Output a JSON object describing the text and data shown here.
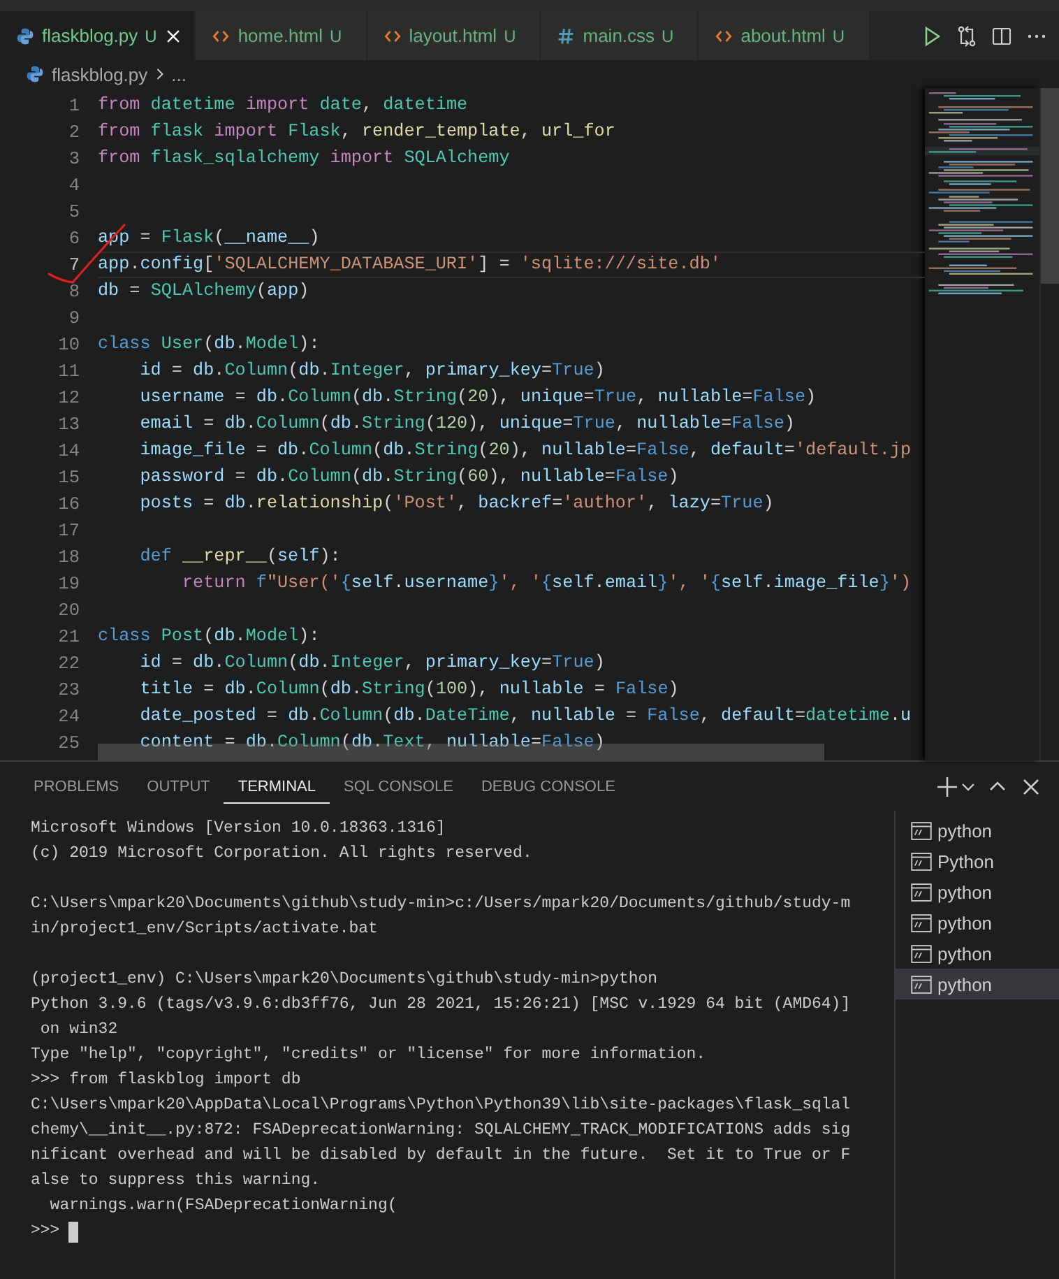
{
  "tabs": [
    {
      "label": "flaskblog.py",
      "status": "U",
      "kind": "python",
      "selected": true
    },
    {
      "label": "home.html",
      "status": "U",
      "kind": "html",
      "selected": false
    },
    {
      "label": "layout.html",
      "status": "U",
      "kind": "html",
      "selected": false
    },
    {
      "label": "main.css",
      "status": "U",
      "kind": "css",
      "selected": false
    },
    {
      "label": "about.html",
      "status": "U",
      "kind": "html",
      "selected": false
    }
  ],
  "breadcrumb": {
    "file": "flaskblog.py",
    "trail": "..."
  },
  "editor": {
    "lines": [
      {
        "number": "1",
        "current": false,
        "tokens": [
          {
            "kind": "keyword",
            "text": "from "
          },
          {
            "kind": "type",
            "text": "datetime "
          },
          {
            "kind": "keyword",
            "text": "import "
          },
          {
            "kind": "type",
            "text": "date"
          },
          {
            "kind": "plain",
            "text": ", "
          },
          {
            "kind": "type",
            "text": "datetime"
          }
        ]
      },
      {
        "number": "2",
        "current": false,
        "tokens": [
          {
            "kind": "keyword",
            "text": "from "
          },
          {
            "kind": "type",
            "text": "flask "
          },
          {
            "kind": "keyword",
            "text": "import "
          },
          {
            "kind": "type",
            "text": "Flask"
          },
          {
            "kind": "plain",
            "text": ", "
          },
          {
            "kind": "function",
            "text": "render_template"
          },
          {
            "kind": "plain",
            "text": ", "
          },
          {
            "kind": "function",
            "text": "url_for"
          }
        ]
      },
      {
        "number": "3",
        "current": false,
        "tokens": [
          {
            "kind": "keyword",
            "text": "from "
          },
          {
            "kind": "type",
            "text": "flask_sqlalchemy "
          },
          {
            "kind": "keyword",
            "text": "import "
          },
          {
            "kind": "type",
            "text": "SQLAlchemy"
          }
        ]
      },
      {
        "number": "4",
        "current": false
      },
      {
        "number": "5",
        "current": false
      },
      {
        "number": "6",
        "current": false,
        "tokens": [
          {
            "kind": "variable",
            "text": "app"
          },
          {
            "kind": "plain",
            "text": " = "
          },
          {
            "kind": "type",
            "text": "Flask"
          },
          {
            "kind": "plain",
            "text": "("
          },
          {
            "kind": "variable",
            "text": "__name__"
          },
          {
            "kind": "plain",
            "text": ")"
          }
        ]
      },
      {
        "number": "7",
        "current": true,
        "tokens": [
          {
            "kind": "variable",
            "text": "app"
          },
          {
            "kind": "plain",
            "text": "."
          },
          {
            "kind": "variable",
            "text": "config"
          },
          {
            "kind": "plain",
            "text": "["
          },
          {
            "kind": "string",
            "text": "'SQLALCHEMY_DATABASE_URI'"
          },
          {
            "kind": "plain",
            "text": "] = "
          },
          {
            "kind": "string",
            "text": "'sqlite:///site.db'"
          }
        ]
      },
      {
        "number": "8",
        "current": false,
        "tokens": [
          {
            "kind": "variable",
            "text": "db"
          },
          {
            "kind": "plain",
            "text": " = "
          },
          {
            "kind": "type",
            "text": "SQLAlchemy"
          },
          {
            "kind": "plain",
            "text": "("
          },
          {
            "kind": "variable",
            "text": "app"
          },
          {
            "kind": "plain",
            "text": ")"
          }
        ]
      },
      {
        "number": "9",
        "current": false
      },
      {
        "number": "10",
        "current": false,
        "tokens": [
          {
            "kind": "constant",
            "text": "class "
          },
          {
            "kind": "type",
            "text": "User"
          },
          {
            "kind": "plain",
            "text": "("
          },
          {
            "kind": "variable",
            "text": "db"
          },
          {
            "kind": "plain",
            "text": "."
          },
          {
            "kind": "type",
            "text": "Model"
          },
          {
            "kind": "plain",
            "text": "):"
          }
        ]
      },
      {
        "number": "11",
        "current": false,
        "tokens": [
          {
            "kind": "variable",
            "text": "    id"
          },
          {
            "kind": "plain",
            "text": " = "
          },
          {
            "kind": "variable",
            "text": "db"
          },
          {
            "kind": "plain",
            "text": "."
          },
          {
            "kind": "type",
            "text": "Column"
          },
          {
            "kind": "plain",
            "text": "("
          },
          {
            "kind": "variable",
            "text": "db"
          },
          {
            "kind": "plain",
            "text": "."
          },
          {
            "kind": "type",
            "text": "Integer"
          },
          {
            "kind": "plain",
            "text": ", "
          },
          {
            "kind": "variable",
            "text": "primary_key"
          },
          {
            "kind": "plain",
            "text": "="
          },
          {
            "kind": "constant",
            "text": "True"
          },
          {
            "kind": "plain",
            "text": ")"
          }
        ]
      },
      {
        "number": "12",
        "current": false,
        "tokens": [
          {
            "kind": "variable",
            "text": "    username"
          },
          {
            "kind": "plain",
            "text": " = "
          },
          {
            "kind": "variable",
            "text": "db"
          },
          {
            "kind": "plain",
            "text": "."
          },
          {
            "kind": "type",
            "text": "Column"
          },
          {
            "kind": "plain",
            "text": "("
          },
          {
            "kind": "variable",
            "text": "db"
          },
          {
            "kind": "plain",
            "text": "."
          },
          {
            "kind": "type",
            "text": "String"
          },
          {
            "kind": "plain",
            "text": "("
          },
          {
            "kind": "number",
            "text": "20"
          },
          {
            "kind": "plain",
            "text": "), "
          },
          {
            "kind": "variable",
            "text": "unique"
          },
          {
            "kind": "plain",
            "text": "="
          },
          {
            "kind": "constant",
            "text": "True"
          },
          {
            "kind": "plain",
            "text": ", "
          },
          {
            "kind": "variable",
            "text": "nullable"
          },
          {
            "kind": "plain",
            "text": "="
          },
          {
            "kind": "constant",
            "text": "False"
          },
          {
            "kind": "plain",
            "text": ")"
          }
        ]
      },
      {
        "number": "13",
        "current": false,
        "tokens": [
          {
            "kind": "variable",
            "text": "    email"
          },
          {
            "kind": "plain",
            "text": " = "
          },
          {
            "kind": "variable",
            "text": "db"
          },
          {
            "kind": "plain",
            "text": "."
          },
          {
            "kind": "type",
            "text": "Column"
          },
          {
            "kind": "plain",
            "text": "("
          },
          {
            "kind": "variable",
            "text": "db"
          },
          {
            "kind": "plain",
            "text": "."
          },
          {
            "kind": "type",
            "text": "String"
          },
          {
            "kind": "plain",
            "text": "("
          },
          {
            "kind": "number",
            "text": "120"
          },
          {
            "kind": "plain",
            "text": "), "
          },
          {
            "kind": "variable",
            "text": "unique"
          },
          {
            "kind": "plain",
            "text": "="
          },
          {
            "kind": "constant",
            "text": "True"
          },
          {
            "kind": "plain",
            "text": ", "
          },
          {
            "kind": "variable",
            "text": "nullable"
          },
          {
            "kind": "plain",
            "text": "="
          },
          {
            "kind": "constant",
            "text": "False"
          },
          {
            "kind": "plain",
            "text": ")"
          }
        ]
      },
      {
        "number": "14",
        "current": false,
        "tokens": [
          {
            "kind": "variable",
            "text": "    image_file"
          },
          {
            "kind": "plain",
            "text": " = "
          },
          {
            "kind": "variable",
            "text": "db"
          },
          {
            "kind": "plain",
            "text": "."
          },
          {
            "kind": "type",
            "text": "Column"
          },
          {
            "kind": "plain",
            "text": "("
          },
          {
            "kind": "variable",
            "text": "db"
          },
          {
            "kind": "plain",
            "text": "."
          },
          {
            "kind": "type",
            "text": "String"
          },
          {
            "kind": "plain",
            "text": "("
          },
          {
            "kind": "number",
            "text": "20"
          },
          {
            "kind": "plain",
            "text": "), "
          },
          {
            "kind": "variable",
            "text": "nullable"
          },
          {
            "kind": "plain",
            "text": "="
          },
          {
            "kind": "constant",
            "text": "False"
          },
          {
            "kind": "plain",
            "text": ", "
          },
          {
            "kind": "variable",
            "text": "default"
          },
          {
            "kind": "plain",
            "text": "="
          },
          {
            "kind": "string",
            "text": "'default.jp"
          }
        ]
      },
      {
        "number": "15",
        "current": false,
        "tokens": [
          {
            "kind": "variable",
            "text": "    password"
          },
          {
            "kind": "plain",
            "text": " = "
          },
          {
            "kind": "variable",
            "text": "db"
          },
          {
            "kind": "plain",
            "text": "."
          },
          {
            "kind": "type",
            "text": "Column"
          },
          {
            "kind": "plain",
            "text": "("
          },
          {
            "kind": "variable",
            "text": "db"
          },
          {
            "kind": "plain",
            "text": "."
          },
          {
            "kind": "type",
            "text": "String"
          },
          {
            "kind": "plain",
            "text": "("
          },
          {
            "kind": "number",
            "text": "60"
          },
          {
            "kind": "plain",
            "text": "), "
          },
          {
            "kind": "variable",
            "text": "nullable"
          },
          {
            "kind": "plain",
            "text": "="
          },
          {
            "kind": "constant",
            "text": "False"
          },
          {
            "kind": "plain",
            "text": ")"
          }
        ]
      },
      {
        "number": "16",
        "current": false,
        "tokens": [
          {
            "kind": "variable",
            "text": "    posts"
          },
          {
            "kind": "plain",
            "text": " = "
          },
          {
            "kind": "variable",
            "text": "db"
          },
          {
            "kind": "plain",
            "text": "."
          },
          {
            "kind": "function",
            "text": "relationship"
          },
          {
            "kind": "plain",
            "text": "("
          },
          {
            "kind": "string",
            "text": "'Post'"
          },
          {
            "kind": "plain",
            "text": ", "
          },
          {
            "kind": "variable",
            "text": "backref"
          },
          {
            "kind": "plain",
            "text": "="
          },
          {
            "kind": "string",
            "text": "'author'"
          },
          {
            "kind": "plain",
            "text": ", "
          },
          {
            "kind": "variable",
            "text": "lazy"
          },
          {
            "kind": "plain",
            "text": "="
          },
          {
            "kind": "constant",
            "text": "True"
          },
          {
            "kind": "plain",
            "text": ")"
          }
        ]
      },
      {
        "number": "17",
        "current": false
      },
      {
        "number": "18",
        "current": false,
        "tokens": [
          {
            "kind": "constant",
            "text": "    def "
          },
          {
            "kind": "function",
            "text": "__repr__"
          },
          {
            "kind": "plain",
            "text": "("
          },
          {
            "kind": "variable",
            "text": "self"
          },
          {
            "kind": "plain",
            "text": "):"
          }
        ]
      },
      {
        "number": "19",
        "current": false,
        "tokens": [
          {
            "kind": "keyword",
            "text": "        return "
          },
          {
            "kind": "constant",
            "text": "f"
          },
          {
            "kind": "string",
            "text": "\"User('"
          },
          {
            "kind": "constant",
            "text": "{"
          },
          {
            "kind": "variable",
            "text": "self"
          },
          {
            "kind": "plain",
            "text": "."
          },
          {
            "kind": "variable",
            "text": "username"
          },
          {
            "kind": "constant",
            "text": "}"
          },
          {
            "kind": "string",
            "text": "', '"
          },
          {
            "kind": "constant",
            "text": "{"
          },
          {
            "kind": "variable",
            "text": "self"
          },
          {
            "kind": "plain",
            "text": "."
          },
          {
            "kind": "variable",
            "text": "email"
          },
          {
            "kind": "constant",
            "text": "}"
          },
          {
            "kind": "string",
            "text": "', '"
          },
          {
            "kind": "constant",
            "text": "{"
          },
          {
            "kind": "variable",
            "text": "self"
          },
          {
            "kind": "plain",
            "text": "."
          },
          {
            "kind": "variable",
            "text": "image_file"
          },
          {
            "kind": "constant",
            "text": "}"
          },
          {
            "kind": "string",
            "text": "')"
          }
        ]
      },
      {
        "number": "20",
        "current": false
      },
      {
        "number": "21",
        "current": false,
        "tokens": [
          {
            "kind": "constant",
            "text": "class "
          },
          {
            "kind": "type",
            "text": "Post"
          },
          {
            "kind": "plain",
            "text": "("
          },
          {
            "kind": "variable",
            "text": "db"
          },
          {
            "kind": "plain",
            "text": "."
          },
          {
            "kind": "type",
            "text": "Model"
          },
          {
            "kind": "plain",
            "text": "):"
          }
        ]
      },
      {
        "number": "22",
        "current": false,
        "tokens": [
          {
            "kind": "variable",
            "text": "    id"
          },
          {
            "kind": "plain",
            "text": " = "
          },
          {
            "kind": "variable",
            "text": "db"
          },
          {
            "kind": "plain",
            "text": "."
          },
          {
            "kind": "type",
            "text": "Column"
          },
          {
            "kind": "plain",
            "text": "("
          },
          {
            "kind": "variable",
            "text": "db"
          },
          {
            "kind": "plain",
            "text": "."
          },
          {
            "kind": "type",
            "text": "Integer"
          },
          {
            "kind": "plain",
            "text": ", "
          },
          {
            "kind": "variable",
            "text": "primary_key"
          },
          {
            "kind": "plain",
            "text": "="
          },
          {
            "kind": "constant",
            "text": "True"
          },
          {
            "kind": "plain",
            "text": ")"
          }
        ]
      },
      {
        "number": "23",
        "current": false,
        "tokens": [
          {
            "kind": "variable",
            "text": "    title"
          },
          {
            "kind": "plain",
            "text": " = "
          },
          {
            "kind": "variable",
            "text": "db"
          },
          {
            "kind": "plain",
            "text": "."
          },
          {
            "kind": "type",
            "text": "Column"
          },
          {
            "kind": "plain",
            "text": "("
          },
          {
            "kind": "variable",
            "text": "db"
          },
          {
            "kind": "plain",
            "text": "."
          },
          {
            "kind": "type",
            "text": "String"
          },
          {
            "kind": "plain",
            "text": "("
          },
          {
            "kind": "number",
            "text": "100"
          },
          {
            "kind": "plain",
            "text": "), "
          },
          {
            "kind": "variable",
            "text": "nullable"
          },
          {
            "kind": "plain",
            "text": " = "
          },
          {
            "kind": "constant",
            "text": "False"
          },
          {
            "kind": "plain",
            "text": ")"
          }
        ]
      },
      {
        "number": "24",
        "current": false,
        "tokens": [
          {
            "kind": "variable",
            "text": "    date_posted"
          },
          {
            "kind": "plain",
            "text": " = "
          },
          {
            "kind": "variable",
            "text": "db"
          },
          {
            "kind": "plain",
            "text": "."
          },
          {
            "kind": "type",
            "text": "Column"
          },
          {
            "kind": "plain",
            "text": "("
          },
          {
            "kind": "variable",
            "text": "db"
          },
          {
            "kind": "plain",
            "text": "."
          },
          {
            "kind": "type",
            "text": "DateTime"
          },
          {
            "kind": "plain",
            "text": ", "
          },
          {
            "kind": "variable",
            "text": "nullable"
          },
          {
            "kind": "plain",
            "text": " = "
          },
          {
            "kind": "constant",
            "text": "False"
          },
          {
            "kind": "plain",
            "text": ", "
          },
          {
            "kind": "variable",
            "text": "default"
          },
          {
            "kind": "plain",
            "text": "="
          },
          {
            "kind": "type",
            "text": "datetime"
          },
          {
            "kind": "plain",
            "text": "."
          },
          {
            "kind": "variable",
            "text": "u"
          }
        ]
      },
      {
        "number": "25",
        "current": false,
        "tokens": [
          {
            "kind": "variable",
            "text": "    content"
          },
          {
            "kind": "plain",
            "text": " = "
          },
          {
            "kind": "variable",
            "text": "db"
          },
          {
            "kind": "plain",
            "text": "."
          },
          {
            "kind": "type",
            "text": "Column"
          },
          {
            "kind": "plain",
            "text": "("
          },
          {
            "kind": "variable",
            "text": "db"
          },
          {
            "kind": "plain",
            "text": "."
          },
          {
            "kind": "type",
            "text": "Text"
          },
          {
            "kind": "plain",
            "text": ", "
          },
          {
            "kind": "variable",
            "text": "nullable"
          },
          {
            "kind": "plain",
            "text": "="
          },
          {
            "kind": "constant",
            "text": "False"
          },
          {
            "kind": "plain",
            "text": ")"
          }
        ]
      }
    ]
  },
  "panel": {
    "tabs": [
      {
        "label": "PROBLEMS",
        "selected": false
      },
      {
        "label": "OUTPUT",
        "selected": false
      },
      {
        "label": "TERMINAL",
        "selected": true
      },
      {
        "label": "SQL CONSOLE",
        "selected": false
      },
      {
        "label": "DEBUG CONSOLE",
        "selected": false
      }
    ],
    "terminal": {
      "blocks": [
        [
          "Microsoft Windows [Version 10.0.18363.1316]",
          "(c) 2019 Microsoft Corporation. All rights reserved."
        ],
        [
          "C:\\Users\\mpark20\\Documents\\github\\study-min>c:/Users/mpark20/Documents/github/study-m",
          "in/project1_env/Scripts/activate.bat"
        ],
        [
          "(project1_env) C:\\Users\\mpark20\\Documents\\github\\study-min>python",
          "Python 3.9.6 (tags/v3.9.6:db3ff76, Jun 28 2021, 15:26:21) [MSC v.1929 64 bit (AMD64)]",
          " on win32",
          "Type \"help\", \"copyright\", \"credits\" or \"license\" for more information.",
          ">>> from flaskblog import db",
          "C:\\Users\\mpark20\\AppData\\Local\\Programs\\Python\\Python39\\lib\\site-packages\\flask_sqlal",
          "chemy\\__init__.py:872: FSADeprecationWarning: SQLALCHEMY_TRACK_MODIFICATIONS adds sig",
          "nificant overhead and will be disabled by default in the future.  Set it to True or F",
          "alse to suppress this warning.",
          "  warnings.warn(FSADeprecationWarning("
        ]
      ],
      "prompt": ">>>"
    },
    "instances": [
      {
        "label": "python",
        "selected": false
      },
      {
        "label": "Python",
        "selected": false
      },
      {
        "label": "python",
        "selected": false
      },
      {
        "label": "python",
        "selected": false
      },
      {
        "label": "python",
        "selected": false
      },
      {
        "label": "python",
        "selected": true
      }
    ]
  }
}
